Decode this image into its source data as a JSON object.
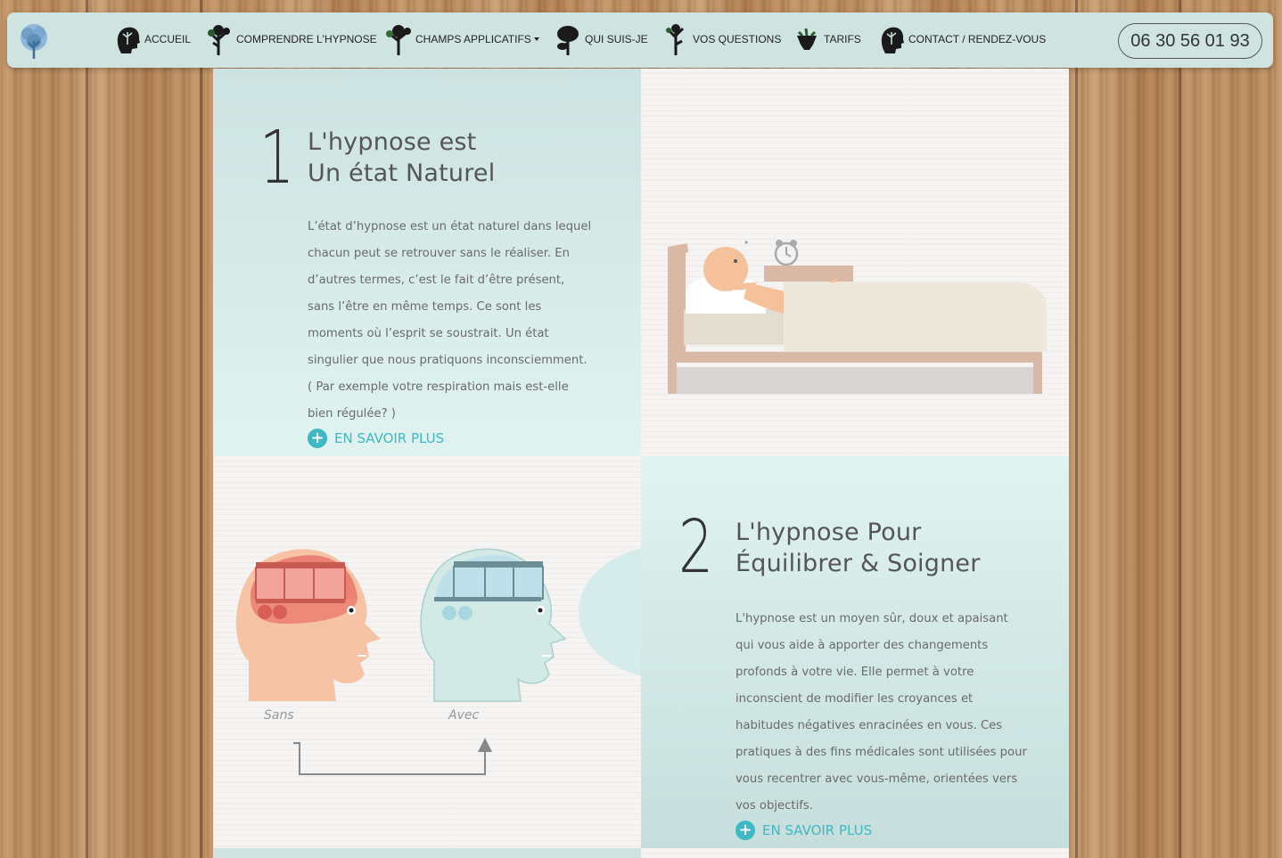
{
  "nav": {
    "items": [
      {
        "label": "ACCUEIL",
        "icon": "head-tree-icon"
      },
      {
        "label": "COMPRENDRE L'HYPNOSE",
        "icon": "tree-icon"
      },
      {
        "label": "CHAMPS APPLICATIFS",
        "icon": "tree-icon",
        "dropdown": true
      },
      {
        "label": "QUI SUIS-JE",
        "icon": "tree-icon"
      },
      {
        "label": "VOS QUESTIONS",
        "icon": "tree-icon"
      },
      {
        "label": "TARIFS",
        "icon": "tree-icon"
      },
      {
        "label": "CONTACT / RENDEZ-VOUS",
        "icon": "head-tree-icon"
      }
    ],
    "phone": "06 30 56 01 93"
  },
  "section1": {
    "number": "1",
    "heading_line1": "L'hypnose est",
    "heading_line2": "Un état Naturel",
    "paragraph": "L’état d’hypnose est un état naturel dans lequel chacun peut se retrouver sans le réaliser. En d’autres termes, c’est le fait d’être présent, sans l’être en même temps. Ce sont les moments où l’esprit se soustrait. Un état singulier que nous pratiquons inconsciemment. ( Par exemple votre respiration mais est-elle bien régulée? )",
    "more_label": "EN SAVOIR PLUS"
  },
  "section2": {
    "number": "2",
    "heading_line1": "L'hypnose Pour",
    "heading_line2": "Équilibrer & Soigner",
    "paragraph": "L'hypnose est un moyen sûr, doux et apaisant qui vous aide à apporter des changements profonds à votre vie. Elle permet à votre inconscient de modifier les croyances et habitudes négatives enracinées en vous. Ces pratiques à des fins médicales sont utilisées pour vous recentrer avec vous-même, orientées vers vos objectifs.",
    "more_label": "EN SAVOIR PLUS"
  },
  "illustration": {
    "caption_left": "Sans",
    "caption_right": "Avec"
  },
  "colors": {
    "accent": "#3db8c4",
    "nav_bg": "#cfe4e1",
    "head_orange": "#f5c3a3",
    "head_teal": "#d2e9e6"
  }
}
